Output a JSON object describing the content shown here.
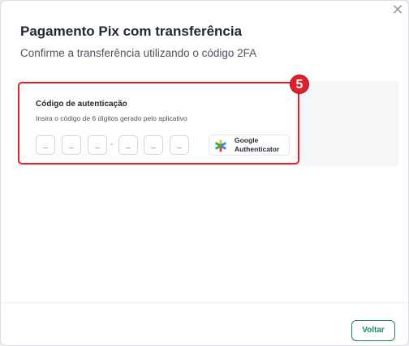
{
  "modal": {
    "title": "Pagamento Pix com transferência",
    "subtitle": "Confirme a transferência utilizando o código 2FA",
    "close_icon": "close-icon"
  },
  "auth": {
    "badge": "5",
    "title": "Código de autenticação",
    "description": "Insira o código de 6 dígitos gerado pelo aplicativo",
    "digit_placeholder": "_",
    "separator": "-",
    "google_auth": {
      "line1": "Google",
      "line2": "Authenticator",
      "icon": "google-authenticator-icon"
    }
  },
  "footer": {
    "back_label": "Voltar"
  },
  "colors": {
    "highlight": "#e0202a",
    "primary": "#1f8a5b"
  }
}
